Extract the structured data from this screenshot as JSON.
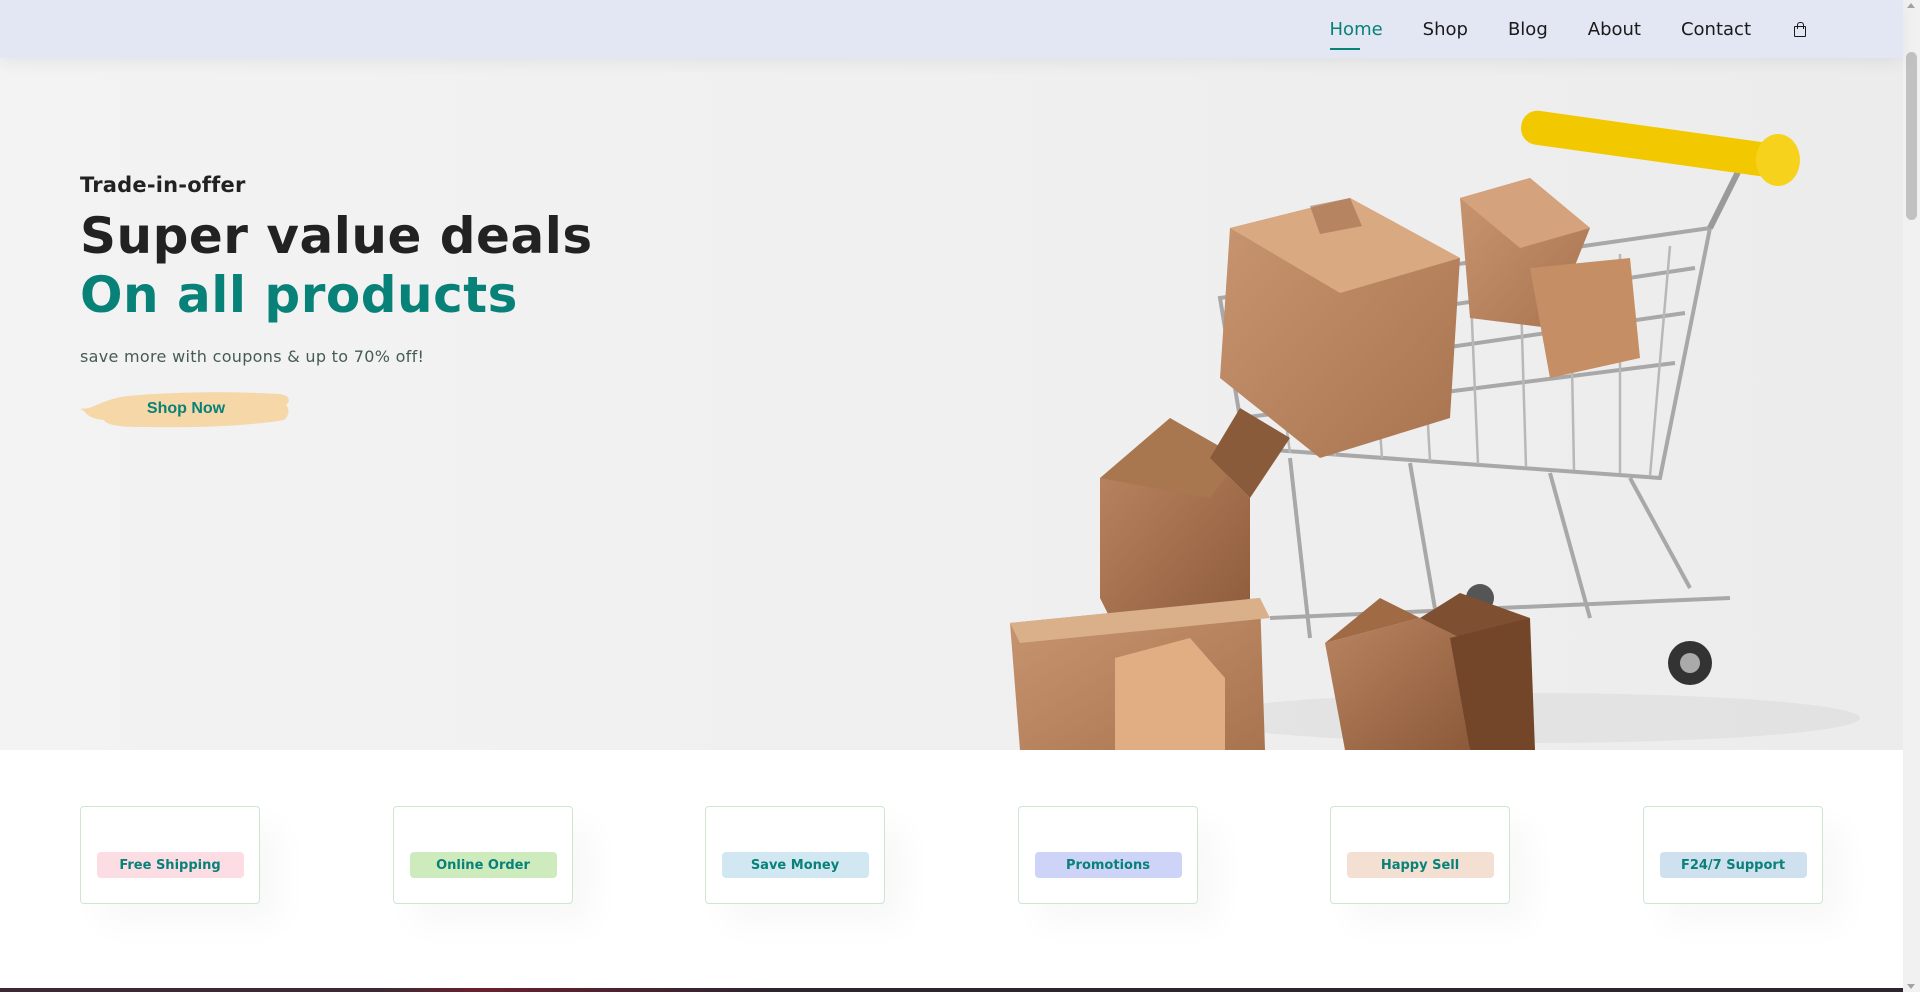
{
  "nav": {
    "items": [
      {
        "label": "Home",
        "active": true
      },
      {
        "label": "Shop",
        "active": false
      },
      {
        "label": "Blog",
        "active": false
      },
      {
        "label": "About",
        "active": false
      },
      {
        "label": "Contact",
        "active": false
      }
    ],
    "cart_icon": "shopping-bag-icon"
  },
  "hero": {
    "kicker": "Trade-in-offer",
    "headline": "Super value deals",
    "headline_accent": "On all products",
    "subtitle": "save more with coupons & up to 70% off!",
    "button_label": "Shop Now",
    "image": "shopping-cart-with-boxes"
  },
  "features": [
    {
      "label": "Free Shipping",
      "color": "#fddde4"
    },
    {
      "label": "Online Order",
      "color": "#cdebbc"
    },
    {
      "label": "Save Money",
      "color": "#d1e8f2"
    },
    {
      "label": "Promotions",
      "color": "#cdd4f8"
    },
    {
      "label": "Happy Sell",
      "color": "#f6dbf6"
    },
    {
      "label": "F24/7 Support",
      "color": "#fff2e5"
    }
  ],
  "colors": {
    "accent": "#088178",
    "header_bg": "#e3e6f3",
    "button_brush": "#f5d7a8"
  }
}
